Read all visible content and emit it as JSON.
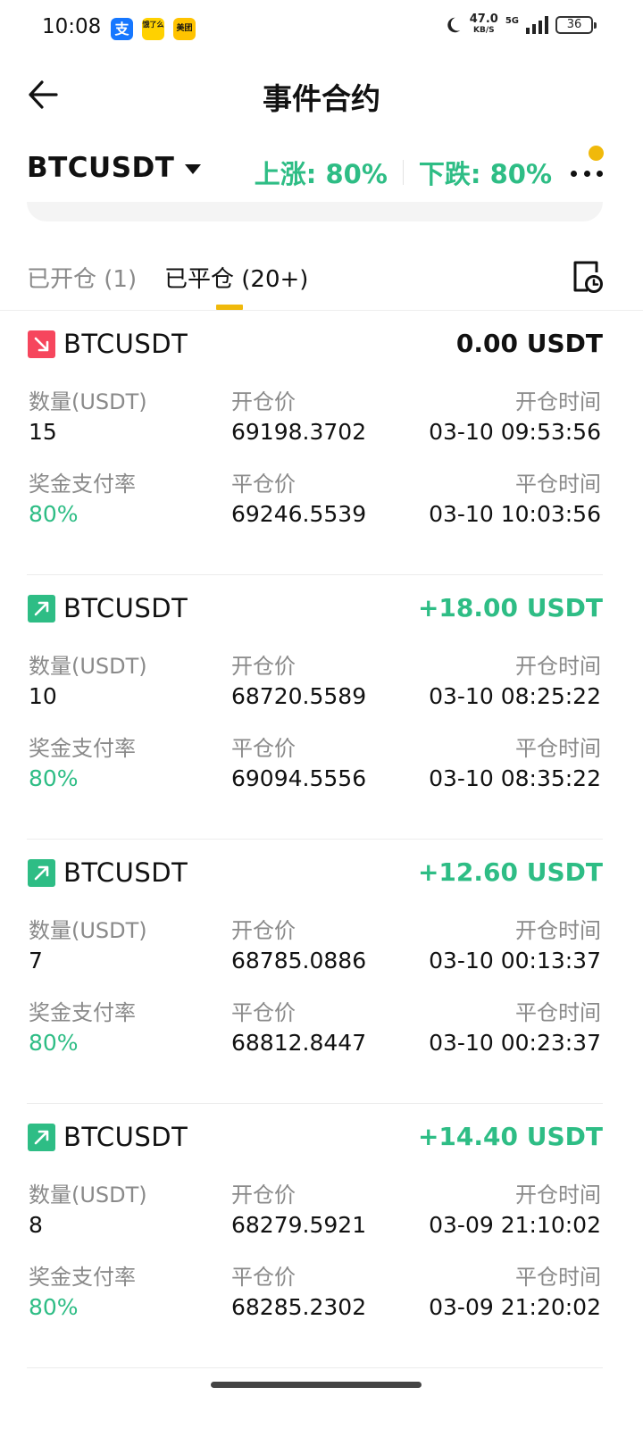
{
  "status_bar": {
    "time": "10:08",
    "app_icons": [
      {
        "name": "alipay-app-icon",
        "glyph": "支"
      },
      {
        "name": "eleme-app-icon",
        "glyph": "饿了么"
      },
      {
        "name": "meituan-app-icon",
        "glyph": "美团"
      }
    ],
    "net_speed": "47.0",
    "net_unit": "KB/S",
    "network": "5G",
    "battery": "36"
  },
  "header": {
    "title": "事件合约",
    "back_icon": "arrow-left-icon"
  },
  "symbol_bar": {
    "symbol": "BTCUSDT",
    "up_rate": "上涨: 80%",
    "down_rate": "下跌: 80%",
    "more_icon": "more-dots-icon"
  },
  "tabs": {
    "open": "已开仓 (1)",
    "closed": "已平仓 (20+)",
    "active": "closed",
    "history_icon": "history-document-icon"
  },
  "labels": {
    "amount": "数量(USDT)",
    "open_price": "开仓价",
    "open_time": "开仓时间",
    "payout_rate": "奖金支付率",
    "close_price": "平仓价",
    "close_time": "平仓时间"
  },
  "records": [
    {
      "direction": "down",
      "symbol": "BTCUSDT",
      "pnl": "0.00 USDT",
      "amount": "15",
      "open_price": "69198.3702",
      "open_time": "03-10 09:53:56",
      "payout_rate": "80%",
      "close_price": "69246.5539",
      "close_time": "03-10 10:03:56"
    },
    {
      "direction": "up",
      "symbol": "BTCUSDT",
      "pnl": "+18.00 USDT",
      "amount": "10",
      "open_price": "68720.5589",
      "open_time": "03-10 08:25:22",
      "payout_rate": "80%",
      "close_price": "69094.5556",
      "close_time": "03-10 08:35:22"
    },
    {
      "direction": "up",
      "symbol": "BTCUSDT",
      "pnl": "+12.60 USDT",
      "amount": "7",
      "open_price": "68785.0886",
      "open_time": "03-10 00:13:37",
      "payout_rate": "80%",
      "close_price": "68812.8447",
      "close_time": "03-10 00:23:37"
    },
    {
      "direction": "up",
      "symbol": "BTCUSDT",
      "pnl": "+14.40 USDT",
      "amount": "8",
      "open_price": "68279.5921",
      "open_time": "03-09 21:10:02",
      "payout_rate": "80%",
      "close_price": "68285.2302",
      "close_time": "03-09 21:20:02"
    }
  ],
  "colors": {
    "profit_green": "#2ebd85",
    "loss_red": "#f6465d",
    "accent_yellow": "#f0b90b"
  }
}
